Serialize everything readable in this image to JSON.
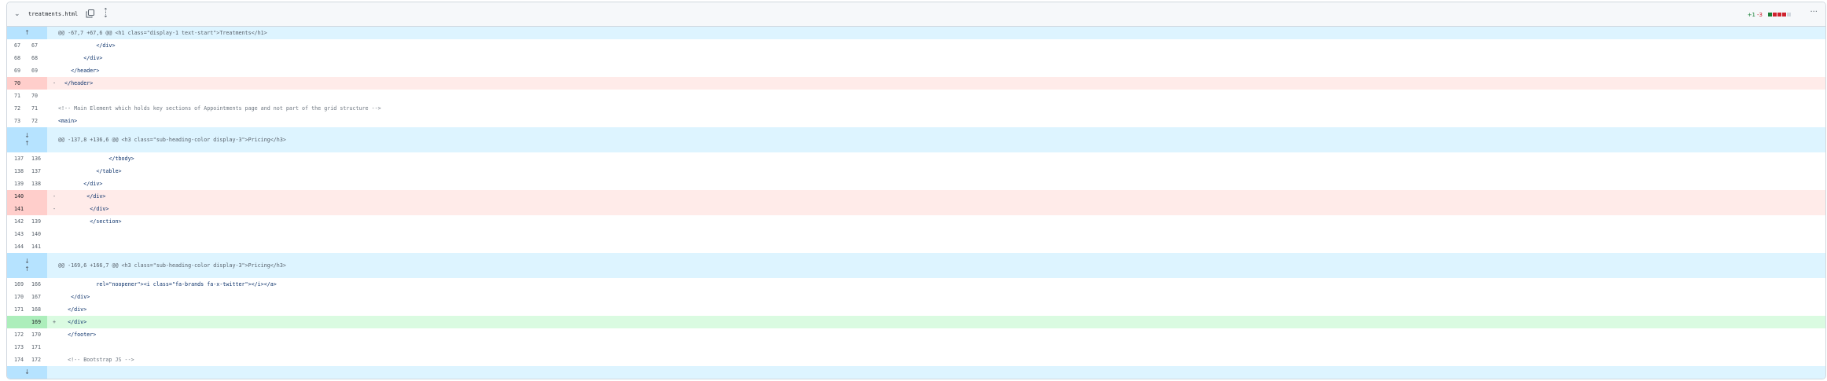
{
  "file": {
    "name": "treatments.html",
    "additions": "+1",
    "deletions": "-3",
    "diffstat_blocks": [
      "added",
      "deleted",
      "deleted",
      "deleted",
      "neutral"
    ],
    "colors": {
      "added": "#1a7f37",
      "deleted": "#cf222e",
      "neutral": "#d0d7de"
    }
  },
  "hunks": [
    {
      "header": "@@ -67,7 +67,6 @@ <h1 class=\"display-1 text-start\">Treatments</h1>",
      "expand": "up",
      "lines": [
        {
          "old": "67",
          "new": "67",
          "type": "ctx",
          "code": "            </div>"
        },
        {
          "old": "68",
          "new": "68",
          "type": "ctx",
          "code": "        </div>"
        },
        {
          "old": "69",
          "new": "69",
          "type": "ctx",
          "code": "    </header>"
        },
        {
          "old": "70",
          "new": "",
          "type": "del",
          "code": "  </header>"
        },
        {
          "old": "71",
          "new": "70",
          "type": "ctx",
          "code": ""
        },
        {
          "old": "72",
          "new": "71",
          "type": "ctx",
          "code": "<!-- Main Element which holds key sections of Appointments page and not part of the grid structure -->"
        },
        {
          "old": "73",
          "new": "72",
          "type": "ctx",
          "code": "<main>"
        }
      ]
    },
    {
      "header": "@@ -137,8 +136,6 @@ <h3 class=\"sub-heading-color display-3\">Pricing</h3>",
      "expand": "both",
      "lines": [
        {
          "old": "137",
          "new": "136",
          "type": "ctx",
          "code": "                </tbody>"
        },
        {
          "old": "138",
          "new": "137",
          "type": "ctx",
          "code": "            </table>"
        },
        {
          "old": "139",
          "new": "138",
          "type": "ctx",
          "code": "        </div>"
        },
        {
          "old": "140",
          "new": "",
          "type": "del",
          "code": "         </div>"
        },
        {
          "old": "141",
          "new": "",
          "type": "del",
          "code": "          </div>"
        },
        {
          "old": "142",
          "new": "139",
          "type": "ctx",
          "code": "          </section>"
        },
        {
          "old": "143",
          "new": "140",
          "type": "ctx",
          "code": ""
        },
        {
          "old": "144",
          "new": "141",
          "type": "ctx",
          "code": ""
        }
      ]
    },
    {
      "header": "@@ -169,6 +166,7 @@ <h3 class=\"sub-heading-color display-3\">Pricing</h3>",
      "expand": "both",
      "lines": [
        {
          "old": "169",
          "new": "166",
          "type": "ctx",
          "code": "            rel=\"noopener\"><i class=\"fa-brands fa-x-twitter\"></i></a>"
        },
        {
          "old": "170",
          "new": "167",
          "type": "ctx",
          "code": "    </div>"
        },
        {
          "old": "171",
          "new": "168",
          "type": "ctx",
          "code": "   </div>"
        },
        {
          "old": "",
          "new": "169",
          "type": "add",
          "code": "   </div>"
        },
        {
          "old": "172",
          "new": "170",
          "type": "ctx",
          "code": "   </footer>"
        },
        {
          "old": "173",
          "new": "171",
          "type": "ctx",
          "code": ""
        },
        {
          "old": "174",
          "new": "172",
          "type": "ctx",
          "code": "   <!-- Bootstrap JS -->"
        }
      ]
    },
    {
      "header": "",
      "expand": "down",
      "lines": []
    }
  ]
}
